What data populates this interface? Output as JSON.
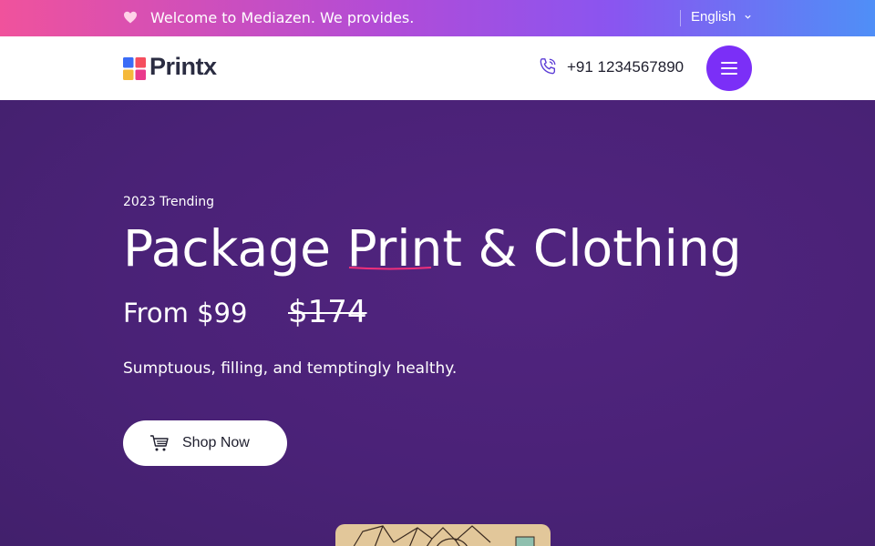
{
  "topbar": {
    "welcome": "Welcome to Mediazen. We provides.",
    "language": "English",
    "heart_icon": "heart-icon",
    "chevron_icon": "chevron-down-icon"
  },
  "header": {
    "brand": "Printx",
    "phone": "+91 1234567890",
    "phone_icon": "phone-icon",
    "menu_icon": "hamburger-menu-icon"
  },
  "hero": {
    "eyebrow": "2023 Trending",
    "headline": "Package Print & Clothing",
    "price": "From $99",
    "old_price": "$174",
    "tagline": "Sumptuous, filling, and temptingly healthy.",
    "cta_label": "Shop Now",
    "cta_icon": "cart-icon"
  },
  "colors": {
    "accent": "#7b2ff7",
    "hero_bg": "#4c2278",
    "underline": "#f0307a",
    "topbar_start": "#f0529c",
    "topbar_end": "#4f8ff7"
  }
}
